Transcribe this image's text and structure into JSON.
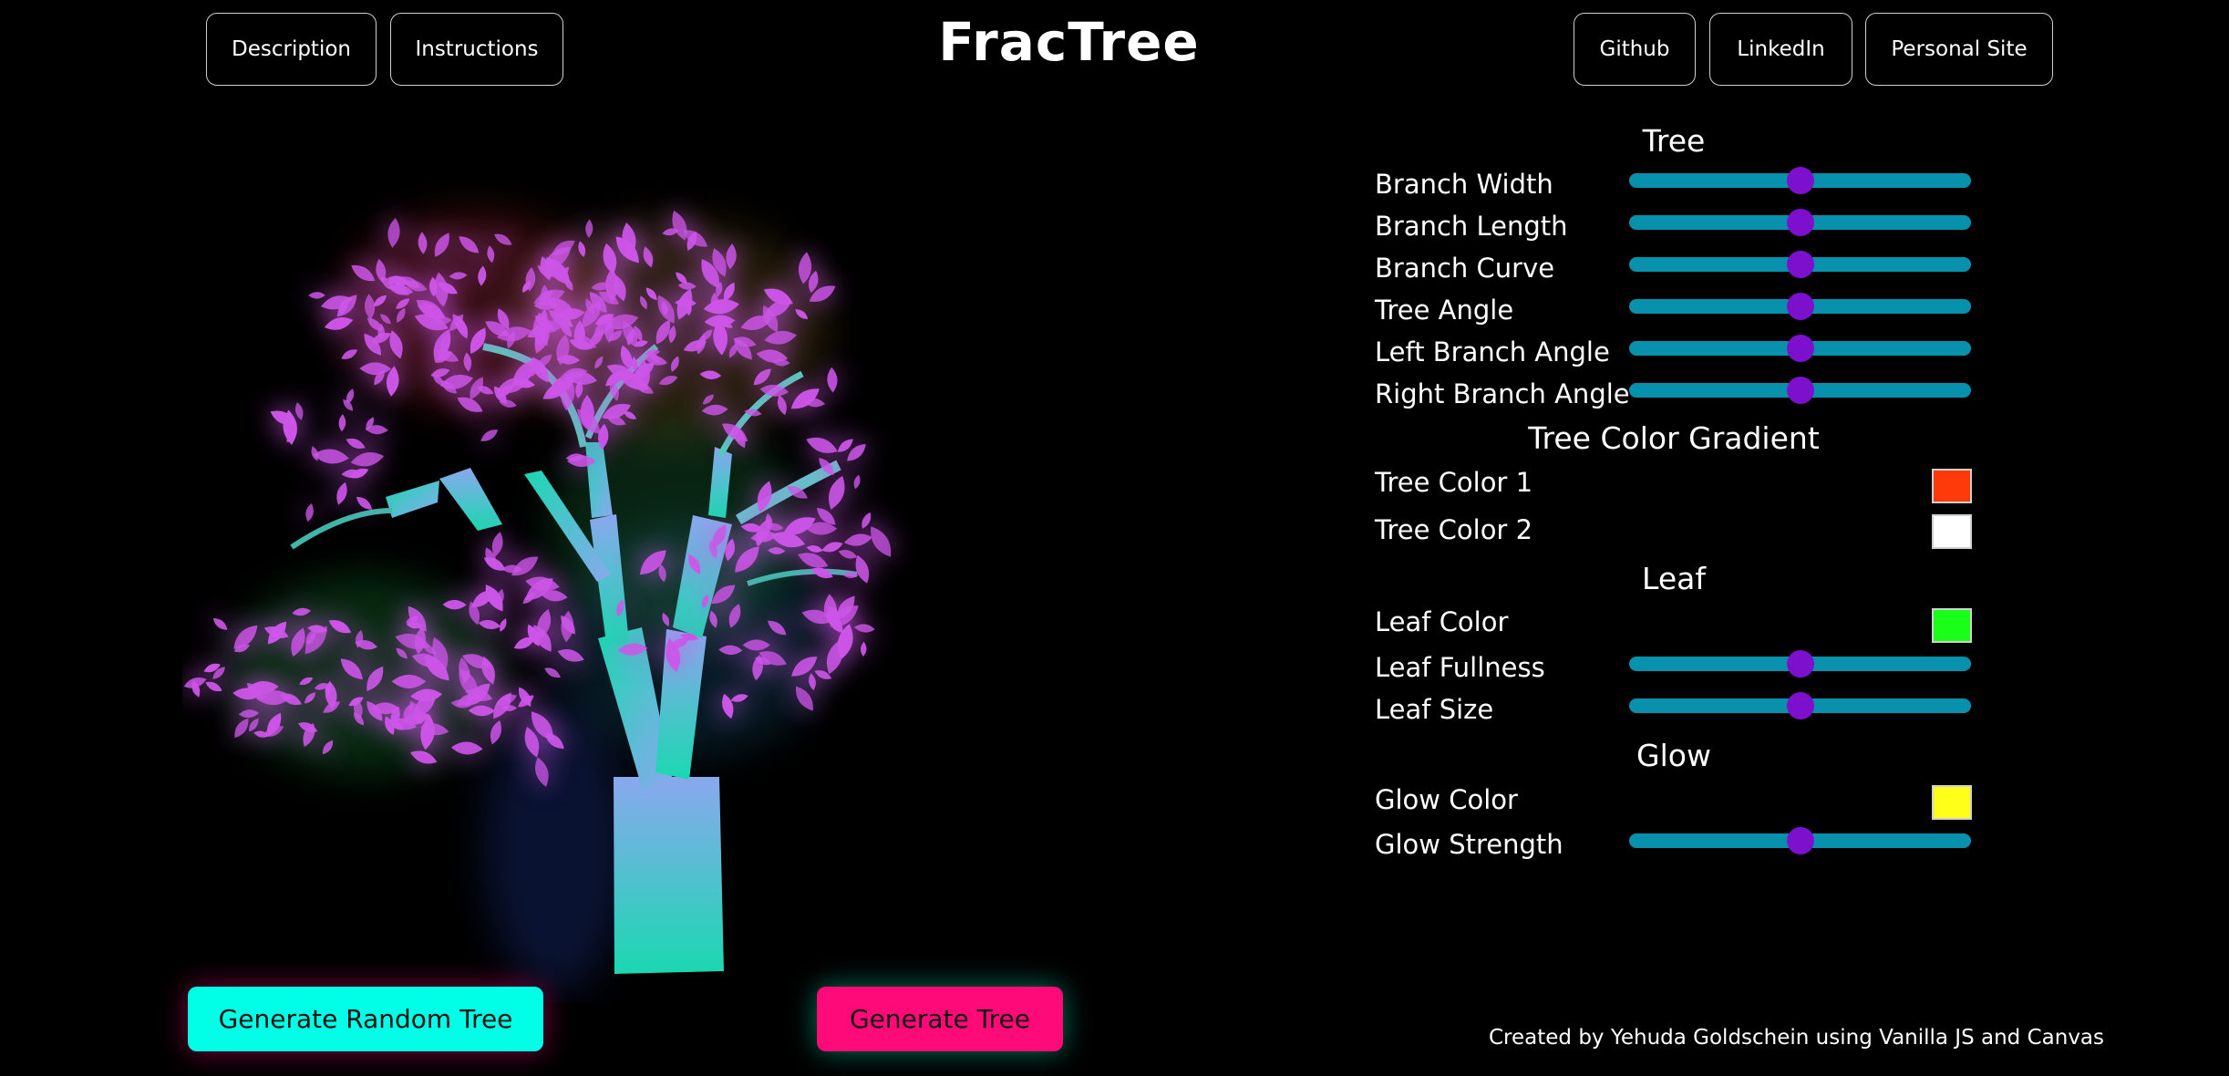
{
  "header": {
    "title": "FracTree",
    "left_nav": [
      {
        "label": "Description"
      },
      {
        "label": "Instructions"
      }
    ],
    "right_nav": [
      {
        "label": "Github"
      },
      {
        "label": "LinkedIn"
      },
      {
        "label": "Personal Site"
      }
    ]
  },
  "actions": {
    "random_label": "Generate Random Tree",
    "generate_label": "Generate Tree"
  },
  "controls": {
    "tree_title": "Tree",
    "branch_width": {
      "label": "Branch Width",
      "value": 0.5
    },
    "branch_length": {
      "label": "Branch Length",
      "value": 0.5
    },
    "branch_curve": {
      "label": "Branch Curve",
      "value": 0.5
    },
    "tree_angle": {
      "label": "Tree Angle",
      "value": 0.5
    },
    "left_branch_angle": {
      "label": "Left Branch Angle",
      "value": 0.5
    },
    "right_branch_angle": {
      "label": "Right Branch Angle",
      "value": 0.5
    },
    "gradient_title": "Tree Color Gradient",
    "tree_color_1": {
      "label": "Tree Color 1",
      "color": "#ff3a0a"
    },
    "tree_color_2": {
      "label": "Tree Color 2",
      "color": "#ffffff"
    },
    "leaf_title": "Leaf",
    "leaf_color": {
      "label": "Leaf Color",
      "color": "#1aff1a"
    },
    "leaf_fullness": {
      "label": "Leaf Fullness",
      "value": 0.5
    },
    "leaf_size": {
      "label": "Leaf Size",
      "value": 0.5
    },
    "glow_title": "Glow",
    "glow_color": {
      "label": "Glow Color",
      "color": "#ffff1a"
    },
    "glow_strength": {
      "label": "Glow Strength",
      "value": 0.5
    }
  },
  "colors": {
    "slider_track": "#0891ac",
    "slider_thumb": "#7d10cc",
    "random_button": "#00ffe6",
    "generate_button": "#ff0a78",
    "leaf_render": "#cc55e8",
    "branch_gradient": [
      "#8aa8ee",
      "#1ad8b0"
    ]
  },
  "footer": {
    "credit": "Created by Yehuda Goldschein using Vanilla JS and Canvas"
  }
}
